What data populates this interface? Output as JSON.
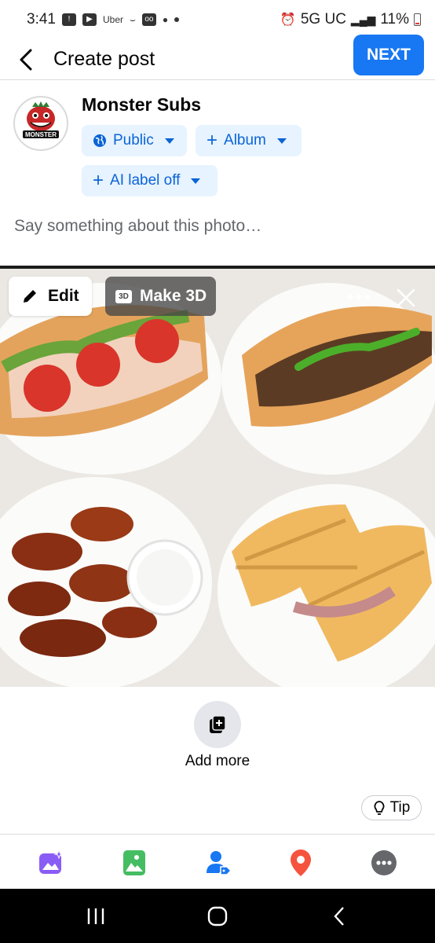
{
  "status_bar": {
    "time": "3:41",
    "uber_label": "Uber",
    "network": "5G UC",
    "battery": "11%"
  },
  "header": {
    "title": "Create post",
    "next_label": "NEXT"
  },
  "author": {
    "name": "Monster Subs",
    "avatar_text": "MONSTER"
  },
  "chips": {
    "privacy": "Public",
    "album": "Album",
    "ai_label": "AI label off"
  },
  "caption": {
    "placeholder": "Say something about this photo…",
    "value": ""
  },
  "photo": {
    "edit_label": "Edit",
    "make3d_label": "Make 3D",
    "badge_3d": "3D"
  },
  "add_more": {
    "label": "Add more"
  },
  "tip": {
    "label": "Tip"
  },
  "toolbar": {
    "items": [
      "ai-image-icon",
      "photo-icon",
      "tag-people-icon",
      "location-pin-icon",
      "more-options-icon"
    ]
  },
  "colors": {
    "accent": "#1877f2",
    "chip_bg": "#e7f3ff",
    "chip_text": "#0a64d6"
  }
}
